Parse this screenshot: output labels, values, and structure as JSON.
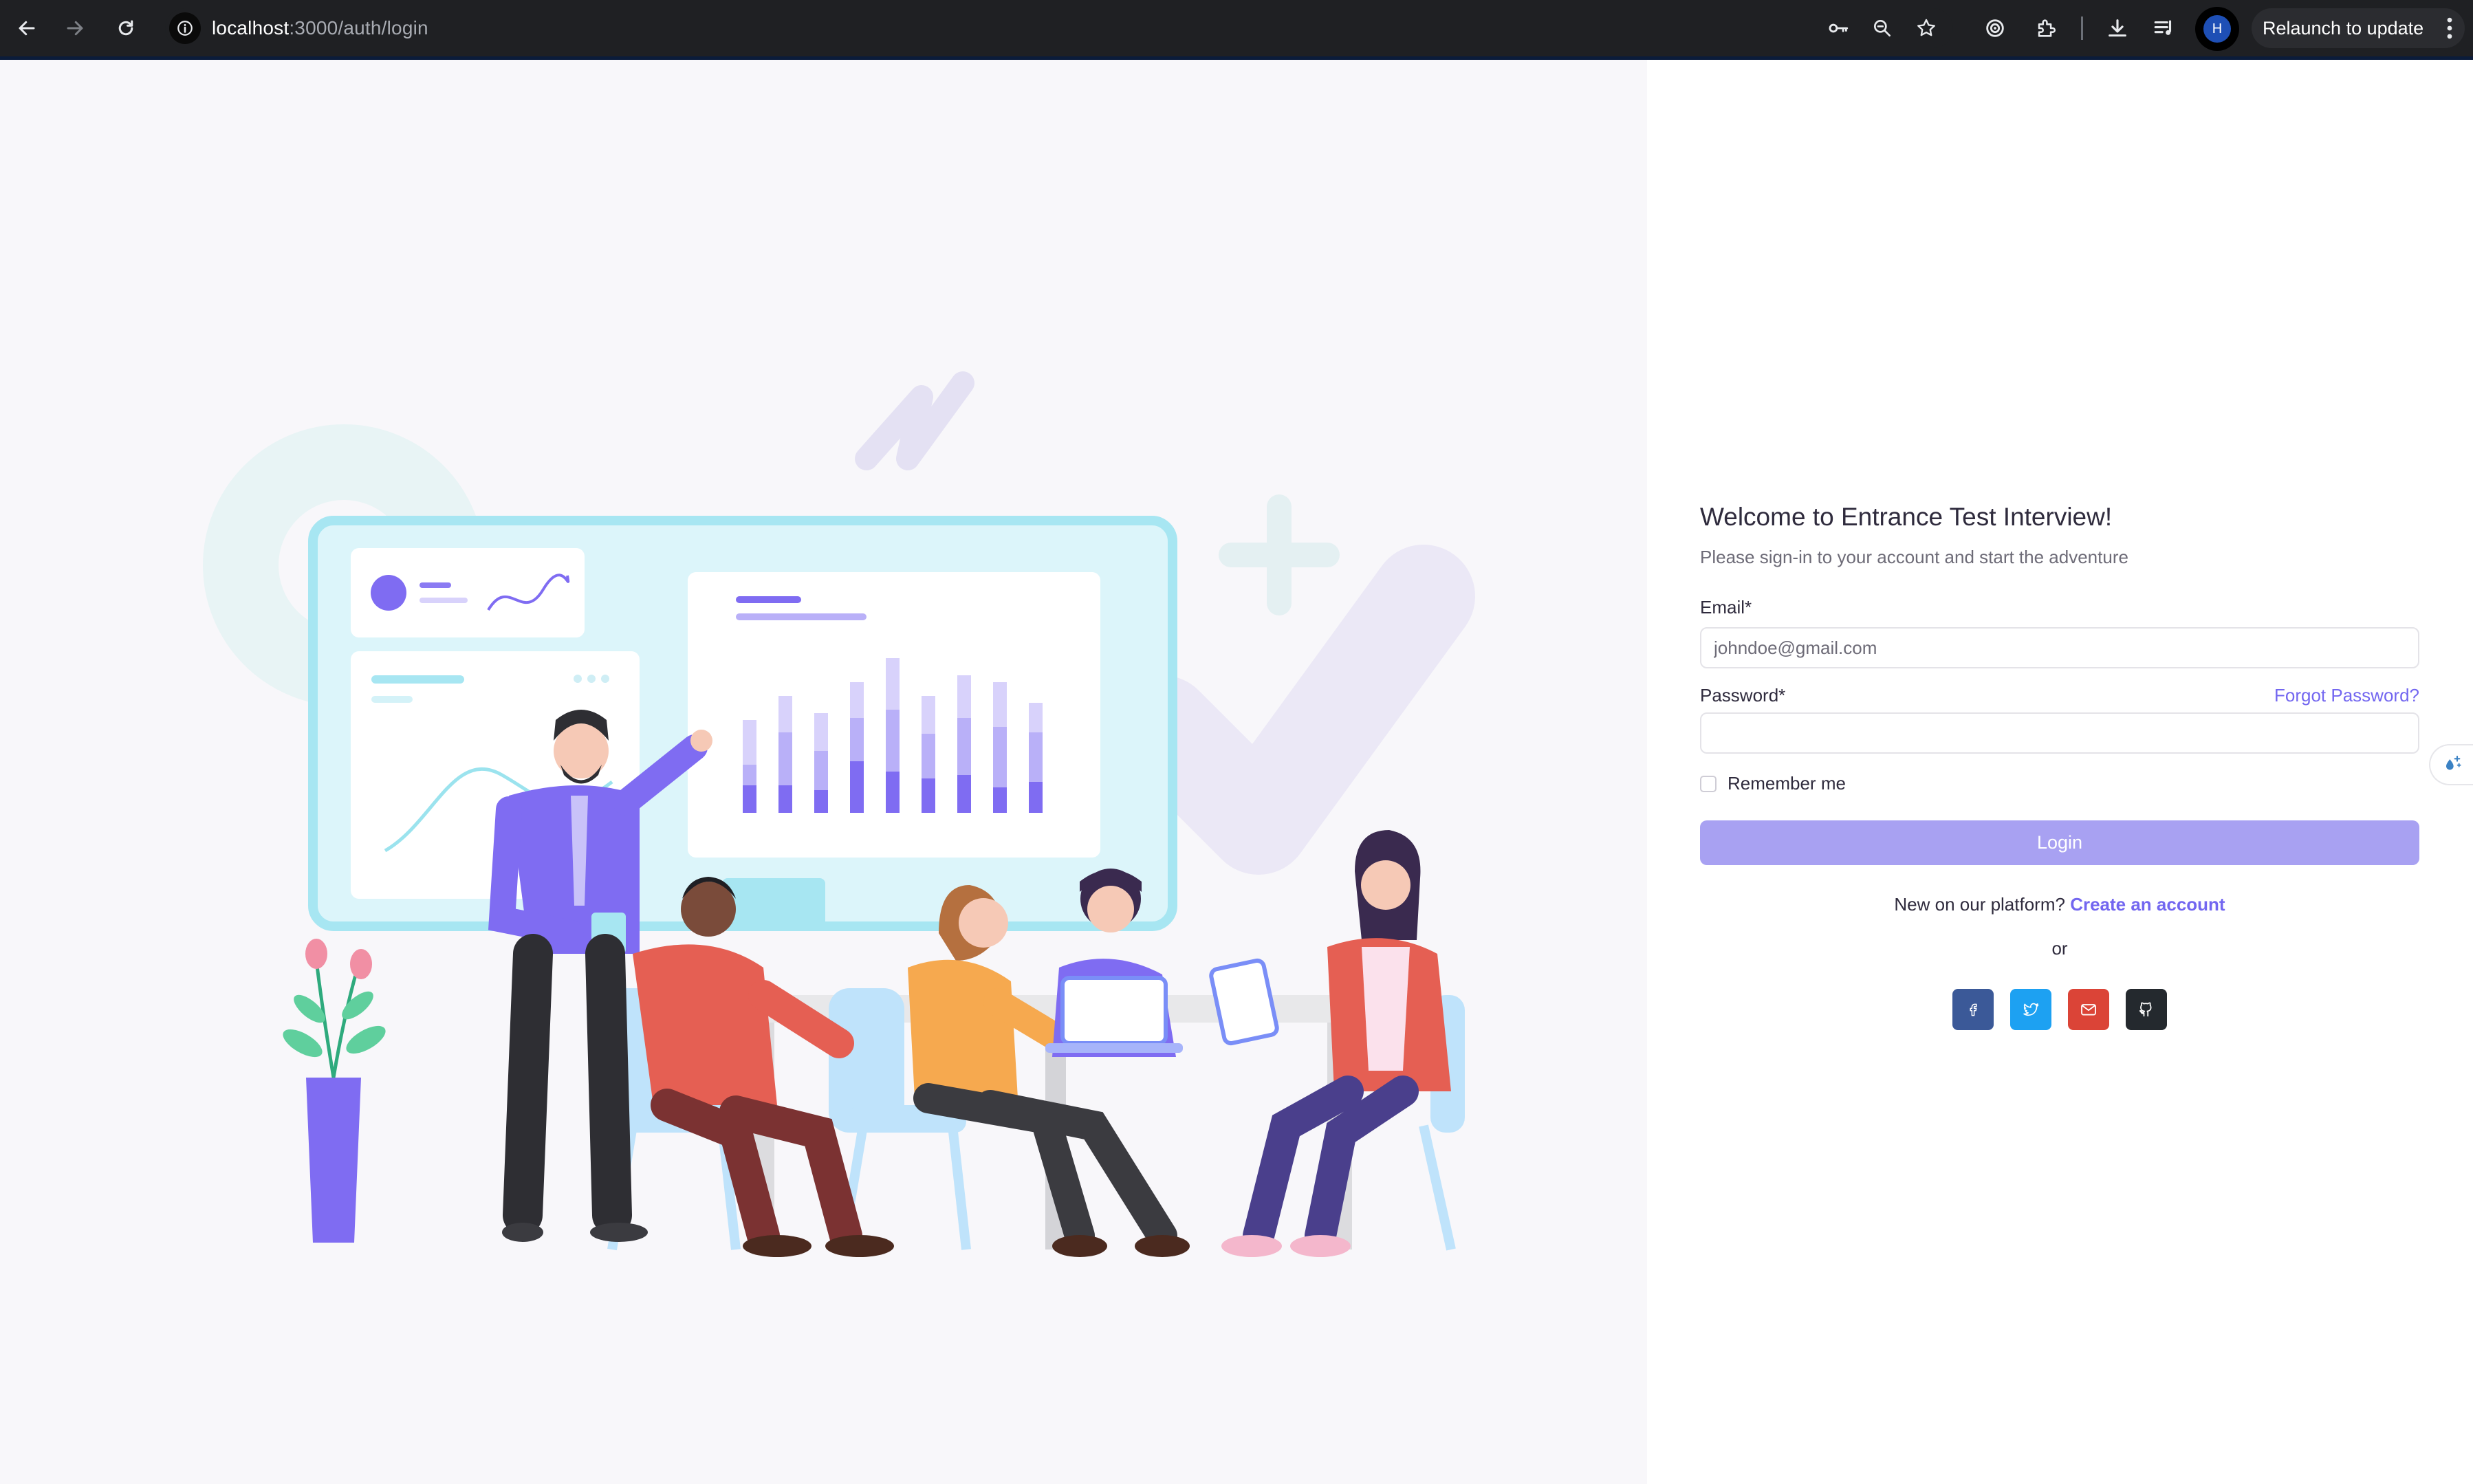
{
  "browser": {
    "url_host": "localhost",
    "url_path": ":3000/auth/login",
    "profile_initial": "H",
    "relaunch_label": "Relaunch to update"
  },
  "login": {
    "title": "Welcome to Entrance Test Interview!",
    "subtitle": "Please sign-in to your account and start the adventure",
    "email_label": "Email*",
    "email_placeholder": "johndoe@gmail.com",
    "email_value": "",
    "password_label": "Password*",
    "password_value": "",
    "forgot_label": "Forgot Password?",
    "remember_label": "Remember me",
    "remember_checked": false,
    "login_button": "Login",
    "new_user_text": "New on our platform?",
    "create_account_label": "Create an account",
    "divider_text": "or",
    "social": [
      {
        "name": "facebook-icon",
        "color": "#3b5998"
      },
      {
        "name": "twitter-icon",
        "color": "#1da1f2"
      },
      {
        "name": "mail-icon",
        "color": "#db4437"
      },
      {
        "name": "github-icon",
        "color": "#24292e"
      }
    ]
  },
  "colors": {
    "primary": "#7367f0",
    "primary_disabled": "#a8a1f2",
    "left_background": "#f8f7fa"
  }
}
